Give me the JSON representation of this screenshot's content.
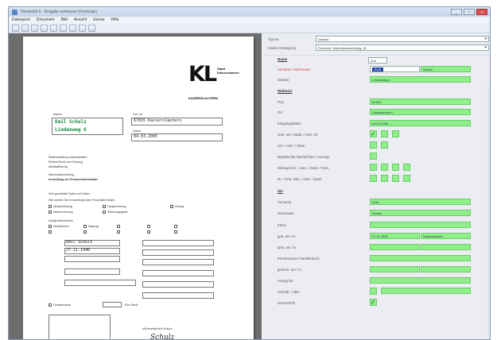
{
  "window": {
    "title": "Nordwind II - Eingabe verfassen (Formular)",
    "minimize": "_",
    "maximize": "□",
    "close": "x"
  },
  "menu": [
    "Datenpool",
    "Dokument",
    "Bild",
    "Ansicht",
    "Extras",
    "Hilfe"
  ],
  "toolbar": [
    "save-icon",
    "open-icon",
    "print-icon",
    "prev-page-icon",
    "next-page-icon",
    "rotate-icon",
    "zoom-in-icon",
    "zoom-out-icon",
    "fit-page-icon"
  ],
  "document": {
    "logo": "KL",
    "logo_sub1": "Stadt",
    "logo_sub2": "Kaiserslautern",
    "logo_line": "KAISERSLAUTERN",
    "aktenz_label": "Aktenz.",
    "hw_name": "Emil Schulz",
    "hw_street": "Lindenweg 6",
    "vorlnr_label": "Vorl.-Nr.",
    "hw_vorl": "67655 Kaiserslautern",
    "datum_label": "Datum",
    "hw_date": "04.03.2005",
    "addr1": "Stadtverwaltung Kaiserslautern",
    "addr2": "Referat Recht und Ordnung",
    "addr3": "Meldeabteilung",
    "wohn_label": "Wohnsitzanmeldung",
    "anmeld_title": "Anmeldung zur Personenstandsdatei",
    "q1": "Sind gemeldete Daten und Daten",
    "q2": "Hier werden Sie im nachfolgenden Personalien Daten",
    "opt1": "Neuanmeldung",
    "opt2": "Nebenwohnung",
    "opt3": "Hauptwohnung",
    "opt4": "Wohnungsgeber",
    "opt5": "Umzug",
    "opt6": "Meldeschein",
    "opt7": "Wegzug",
    "sub1": "Anlagen/Nachweise",
    "hw_name2": "Emil Schulz",
    "hw_date2": "27.11.1946",
    "fam_label": "Familienstand",
    "sig_label": "Mit freundlichen Grüßen",
    "sig": "Schulz",
    "hw_small": "Ehe Stand"
  },
  "form": {
    "typ_label": "Typ/Art",
    "typ_value": "Default",
    "klasse_label": "Klasse (Kategorie)",
    "klasse_value": "Formular: Wohnsitzanmeldung_KL",
    "name_section": "Name",
    "name_tag": "Zurl",
    "vorname_label": "Vorname / Nachname",
    "vorname_value": "Emil",
    "nachname_value": "Schulz",
    "strasse_label": "Strasse",
    "strasse_value": "Lindenweg 6",
    "wohnort_section": "Wohnort",
    "plz_label": "PLZ",
    "plz_value": "67655",
    "ort_label": "Ort",
    "ort_value": "Kaiserslautern",
    "eingang_label": "Eingangsdatum",
    "eingang_value": "04.03.2005",
    "geb1_label": "Geb. am / Stadt. / Geb. ort",
    "geb2_label": "Unt. / Herr. / Stam.",
    "begl_label": "Begleitende Nachrichten / Auszug",
    "eintr_label": "Eintrag Geb. / Herr. / Stam. / Fam.",
    "vers_label": "Nr. / Orts. Geb. / Herr. / Stam.",
    "sie_section": "Sie",
    "sie_vorname_label": "Vorname",
    "sie_vorname_value": "Emil",
    "sie_nachname_label": "Nachname",
    "sie_nachname_value": "Schulz",
    "eltern_label": "Eltern",
    "gebam_label": "geb. am / in",
    "gebam_date": "27.11.1946",
    "gebam_city": "Kaiserslautern",
    "gest_label": "gest. am / in",
    "konf_label": "Konfessionen Familienbuch",
    "gebam2_label": "geborer. am / in",
    "vorstr_label": "Vorstrg für",
    "schreib_label": "Schreib. / aber",
    "unterschr_label": "Unterschrift"
  }
}
